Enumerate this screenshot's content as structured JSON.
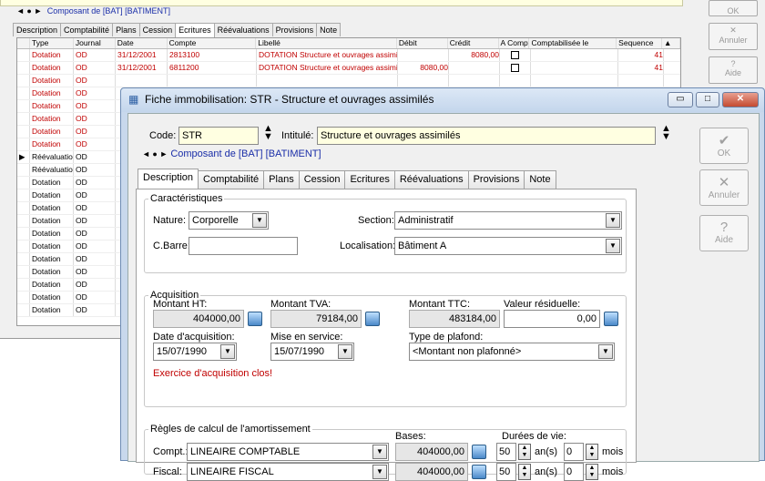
{
  "background": {
    "nav_text": "Composant de [BAT] [BATIMENT]",
    "tabs": [
      "Description",
      "Comptabilité",
      "Plans",
      "Cession",
      "Ecritures",
      "Réévaluations",
      "Provisions",
      "Note"
    ],
    "active_tab": "Ecritures",
    "side_buttons": [
      "OK",
      "Annuler",
      "Aide"
    ],
    "grid": {
      "headers": [
        "Type",
        "Journal",
        "Date",
        "Compte",
        "Libellé",
        "Débit",
        "Crédit",
        "A Compt.",
        "Comptabilisée le",
        "Sequence"
      ],
      "rows": [
        {
          "type": "Dotation",
          "journal": "OD",
          "date": "31/12/2001",
          "compte": "2813100",
          "libelle": "DOTATION Structure et ouvrages assimilé",
          "debit": "",
          "credit": "8080,00",
          "seq": "41",
          "red": true
        },
        {
          "type": "Dotation",
          "journal": "OD",
          "date": "31/12/2001",
          "compte": "6811200",
          "libelle": "DOTATION Structure et ouvrages assimilé",
          "debit": "8080,00",
          "credit": "",
          "seq": "41",
          "red": true
        },
        {
          "type": "Dotation",
          "journal": "OD",
          "red": true
        },
        {
          "type": "Dotation",
          "journal": "OD",
          "red": true
        },
        {
          "type": "Dotation",
          "journal": "OD",
          "red": true
        },
        {
          "type": "Dotation",
          "journal": "OD",
          "red": true
        },
        {
          "type": "Dotation",
          "journal": "OD",
          "red": true
        },
        {
          "type": "Dotation",
          "journal": "OD",
          "red": true
        },
        {
          "type": "Réévaluatio",
          "journal": "OD",
          "red": false,
          "current": true
        },
        {
          "type": "Réévaluatio",
          "journal": "OD",
          "red": false
        },
        {
          "type": "Dotation",
          "journal": "OD",
          "red": false
        },
        {
          "type": "Dotation",
          "journal": "OD",
          "red": false
        },
        {
          "type": "Dotation",
          "journal": "OD",
          "red": false
        },
        {
          "type": "Dotation",
          "journal": "OD",
          "red": false
        },
        {
          "type": "Dotation",
          "journal": "OD",
          "red": false
        },
        {
          "type": "Dotation",
          "journal": "OD",
          "red": false
        },
        {
          "type": "Dotation",
          "journal": "OD",
          "red": false
        },
        {
          "type": "Dotation",
          "journal": "OD",
          "red": false
        },
        {
          "type": "Dotation",
          "journal": "OD",
          "red": false
        },
        {
          "type": "Dotation",
          "journal": "OD",
          "red": false
        },
        {
          "type": "Dotation",
          "journal": "OD",
          "red": false
        }
      ]
    }
  },
  "dialog": {
    "title": "Fiche immobilisation: STR - Structure et ouvrages assimilés",
    "code_label": "Code:",
    "code_value": "STR",
    "intitule_label": "Intitulé:",
    "intitule_value": "Structure et ouvrages assimilés",
    "nav_text": "Composant de [BAT] [BATIMENT]",
    "tabs": [
      "Description",
      "Comptabilité",
      "Plans",
      "Cession",
      "Ecritures",
      "Réévaluations",
      "Provisions",
      "Note"
    ],
    "active_tab": "Description",
    "side_buttons": {
      "ok": "OK",
      "cancel": "Annuler",
      "help": "Aide"
    },
    "caracteristiques": {
      "title": "Caractéristiques",
      "nature_label": "Nature:",
      "nature_value": "Corporelle",
      "section_label": "Section:",
      "section_value": "Administratif",
      "cbarre_label": "C.Barre:",
      "cbarre_value": "",
      "localisation_label": "Localisation:",
      "localisation_value": "Bâtiment A"
    },
    "acquisition": {
      "title": "Acquisition",
      "montant_ht_label": "Montant HT:",
      "montant_ht_value": "404000,00",
      "montant_tva_label": "Montant TVA:",
      "montant_tva_value": "79184,00",
      "montant_ttc_label": "Montant TTC:",
      "montant_ttc_value": "483184,00",
      "valeur_res_label": "Valeur résiduelle:",
      "valeur_res_value": "0,00",
      "date_acq_label": "Date d'acquisition:",
      "date_acq_value": "15/07/1990",
      "mise_service_label": "Mise en service:",
      "mise_service_value": "15/07/1990",
      "plafond_label": "Type de plafond:",
      "plafond_value": "<Montant non plafonné>",
      "warning": "Exercice d'acquisition clos!"
    },
    "regles": {
      "title": "Règles de calcul de l'amortissement",
      "bases_label": "Bases:",
      "durees_label": "Durées de vie:",
      "compt_label": "Compt.:",
      "compt_value": "LINEAIRE COMPTABLE",
      "compt_base": "404000,00",
      "compt_years": "50",
      "compt_months": "0",
      "fiscal_label": "Fiscal:",
      "fiscal_value": "LINEAIRE FISCAL",
      "fiscal_base": "404000,00",
      "fiscal_years": "50",
      "fiscal_months": "0",
      "years_unit": "an(s)",
      "months_unit": "mois"
    }
  }
}
